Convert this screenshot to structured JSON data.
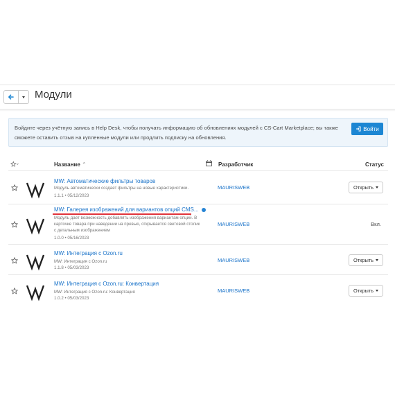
{
  "header": {
    "title": "Модули"
  },
  "notice": {
    "text": "Войдите через учётную запись в Help Desk, чтобы получать информацию об обновлениях модулей с CS-Cart Marketplace; вы также сможете оставить отзыв на купленные модули или продлить подписку на обновления.",
    "login_label": "Войти"
  },
  "table": {
    "col_name": "Название",
    "col_developer": "Разработчик",
    "col_status": "Статус",
    "rows": [
      {
        "name": "MW: Автоматические фильтры товаров",
        "description": "Модуль автоматически создает фильтры на новые характеристики.",
        "version": "1.1.1 • 05/12/2023",
        "developer": "MAURISWEB",
        "action_label": "Открыть",
        "status": ""
      },
      {
        "name": "MW: Галерея изображений для вариантов опций CMS...",
        "description": "Модуль дает возможность добавлять изображения вариантам опций. В карточке товара при наведении на превью, открывается световой столик с детальным изображением",
        "version": "1.0.0 • 05/16/2023",
        "developer": "MAURISWEB",
        "action_label": "",
        "status": "Вкл."
      },
      {
        "name": "MW: Интеграция с Ozon.ru",
        "description": "MW: Интеграция с Ozon.ru",
        "version": "1.1.8 • 05/03/2023",
        "developer": "MAURISWEB",
        "action_label": "Открыть",
        "status": ""
      },
      {
        "name": "MW: Интеграция с Ozon.ru: Конвертация",
        "description": "MW: Интеграция с Ozon.ru: Конвертация",
        "version": "1.0.2 • 05/03/2023",
        "developer": "MAURISWEB",
        "action_label": "Открыть",
        "status": ""
      }
    ]
  },
  "colors": {
    "accent": "#1c86d3",
    "link": "#1a73c9",
    "highlight_underline": "#e0323a",
    "notice_bg": "#eef5fb"
  }
}
